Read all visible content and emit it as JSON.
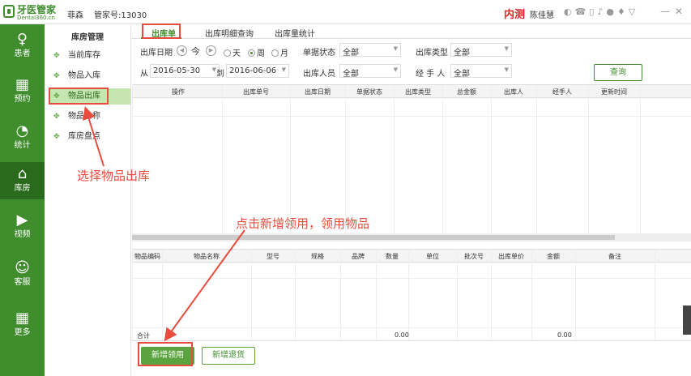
{
  "titlebar": {
    "logo_text": "牙医管家",
    "logo_sub": "Dental360.cn",
    "clinic": "菲森",
    "manager": "管家号:13030",
    "env": "内测",
    "user": "陈佳慧",
    "icons": [
      "weibo-icon",
      "phone-icon",
      "mobile-icon",
      "bell-icon",
      "help-icon",
      "shirt-icon",
      "wifi-icon"
    ]
  },
  "sidebar": {
    "items": [
      {
        "label": "患者",
        "icon": "person-icon",
        "glyph": "♀"
      },
      {
        "label": "预约",
        "icon": "calendar-icon",
        "glyph": "▦"
      },
      {
        "label": "统计",
        "icon": "pie-chart-icon",
        "glyph": "◔"
      },
      {
        "label": "库房",
        "icon": "house-icon",
        "glyph": "⌂"
      },
      {
        "label": "视频",
        "icon": "play-icon",
        "glyph": "▶"
      },
      {
        "label": "客服",
        "icon": "chat-icon",
        "glyph": "☺"
      },
      {
        "label": "更多",
        "icon": "grid-icon",
        "glyph": "▦"
      }
    ]
  },
  "subnav": {
    "title": "库房管理",
    "items": [
      "当前库存",
      "物品入库",
      "物品出库",
      "物品名称",
      "库房盘点"
    ],
    "active_index": 2
  },
  "tabs": [
    "出库单",
    "出库明细查询",
    "出库量统计"
  ],
  "filters": {
    "date_label": "出库日期",
    "today": "今",
    "range_options": [
      "天",
      "周",
      "月"
    ],
    "range_selected": "周",
    "from_label": "从",
    "from_date": "2016-05-30",
    "to_label": "到",
    "to_date": "2016-06-06",
    "status_label": "单据状态",
    "status_value": "全部",
    "person_label": "出库人员",
    "person_value": "全部",
    "type_label": "出库类型",
    "type_value": "全部",
    "handler_label": "经 手 人",
    "handler_value": "全部",
    "query_button": "查询"
  },
  "orders_table": {
    "columns": [
      "操作",
      "出库单号",
      "出库日期",
      "单据状态",
      "出库类型",
      "总金额",
      "出库人",
      "经手人",
      "更新时间"
    ]
  },
  "items_table": {
    "columns": [
      "物品编码",
      "物品名称",
      "型号",
      "规格",
      "品牌",
      "数量",
      "单位",
      "批次号",
      "出库单价",
      "金额",
      "备注"
    ],
    "total_label": "合计",
    "total_qty": "0.00",
    "total_amount": "0.00"
  },
  "footer": {
    "add_button": "新增领用",
    "return_button": "新增退货"
  },
  "annotations": {
    "step1": "选择物品出库",
    "step2": "点击新增领用，领用物品"
  },
  "colors": {
    "brand": "#3f8d2c",
    "accent": "#5aa33e",
    "annotation": "#e74c3c",
    "env": "#e02020"
  }
}
